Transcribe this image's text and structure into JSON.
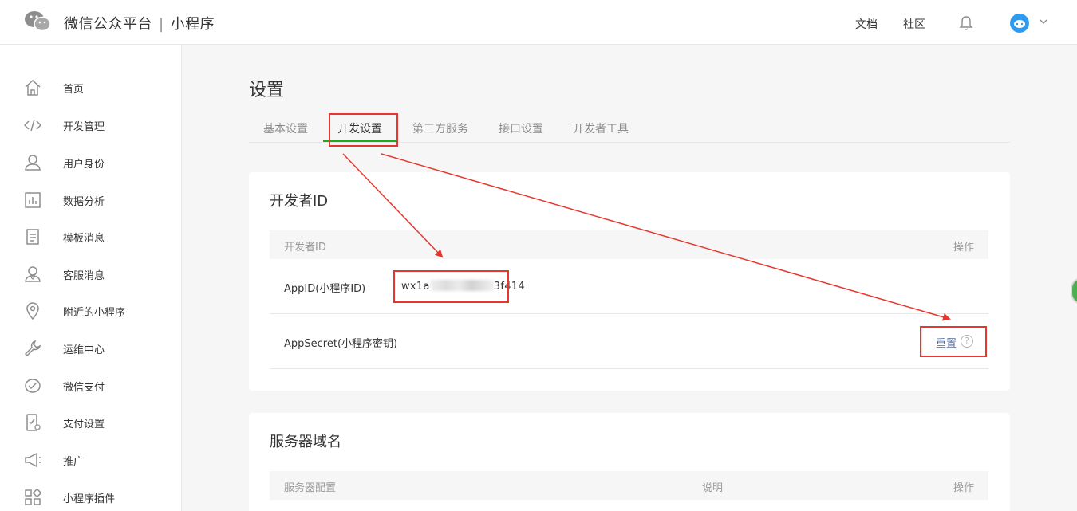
{
  "header": {
    "brand": "微信公众平台",
    "separator": "|",
    "product": "小程序",
    "links": [
      "文档",
      "社区"
    ]
  },
  "sidebar": {
    "items": [
      {
        "label": "首页",
        "icon": "home-icon"
      },
      {
        "label": "开发管理",
        "icon": "code-icon"
      },
      {
        "label": "用户身份",
        "icon": "user-icon"
      },
      {
        "label": "数据分析",
        "icon": "chart-icon"
      },
      {
        "label": "模板消息",
        "icon": "document-icon"
      },
      {
        "label": "客服消息",
        "icon": "support-user-icon"
      },
      {
        "label": "附近的小程序",
        "icon": "location-pin-icon"
      },
      {
        "label": "运维中心",
        "icon": "wrench-icon"
      },
      {
        "label": "微信支付",
        "icon": "pay-icon"
      },
      {
        "label": "支付设置",
        "icon": "phone-settings-icon"
      },
      {
        "label": "推广",
        "icon": "megaphone-icon"
      },
      {
        "label": "小程序插件",
        "icon": "plugin-grid-icon"
      }
    ]
  },
  "main": {
    "title": "设置",
    "tabs": [
      "基本设置",
      "开发设置",
      "第三方服务",
      "接口设置",
      "开发者工具"
    ],
    "active_tab": "开发设置",
    "developer_id": {
      "title": "开发者ID",
      "columns": [
        "开发者ID",
        "操作"
      ],
      "appid_label": "AppID(小程序ID)",
      "appid_prefix": "wx1a",
      "appid_suffix": "3f414",
      "appsecret_label": "AppSecret(小程序密钥)",
      "reset_label": "重置",
      "help": "?"
    },
    "server_domain": {
      "title": "服务器域名",
      "columns": [
        "服务器配置",
        "说明",
        "操作"
      ]
    }
  },
  "colors": {
    "accent_green": "#1aad19",
    "link": "#576b95",
    "annotation_red": "#e8362f"
  }
}
